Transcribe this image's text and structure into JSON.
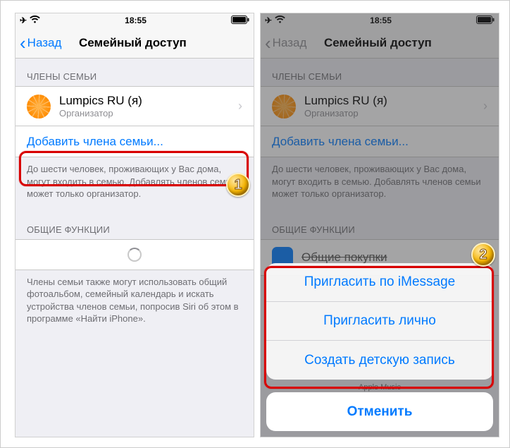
{
  "status": {
    "time": "18:55"
  },
  "nav": {
    "back": "Назад",
    "title": "Семейный доступ"
  },
  "left": {
    "section_members": "ЧЛЕНЫ СЕМЬИ",
    "member_name": "Lumpics RU (я)",
    "member_role": "Организатор",
    "add_member": "Добавить члена семьи...",
    "members_footer": "До шести человек, проживающих у Вас дома, могут входить в семью. Добавлять членов семьи может только организатор.",
    "section_shared": "ОБЩИЕ ФУНКЦИИ",
    "shared_footer": "Члены семьи также могут использовать общий фотоальбом, семейный календарь и искать устройства членов семьи, попросив Siri об этом в программе «Найти iPhone»."
  },
  "right": {
    "section_members": "ЧЛЕНЫ СЕМЬИ",
    "member_name": "Lumpics RU (я)",
    "member_role": "Организатор",
    "add_member": "Добавить члена семьи...",
    "members_footer": "До шести человек, проживающих у Вас дома, могут входить в семью. Добавлять членов семьи может только организатор.",
    "section_shared": "ОБЩИЕ ФУНКЦИИ",
    "peek_row": "Общие покупки",
    "peek_row2": "Apple Music"
  },
  "sheet": {
    "opt1": "Пригласить по iMessage",
    "opt2": "Пригласить лично",
    "opt3": "Создать детскую запись",
    "cancel": "Отменить"
  },
  "badges": {
    "one": "1",
    "two": "2"
  }
}
